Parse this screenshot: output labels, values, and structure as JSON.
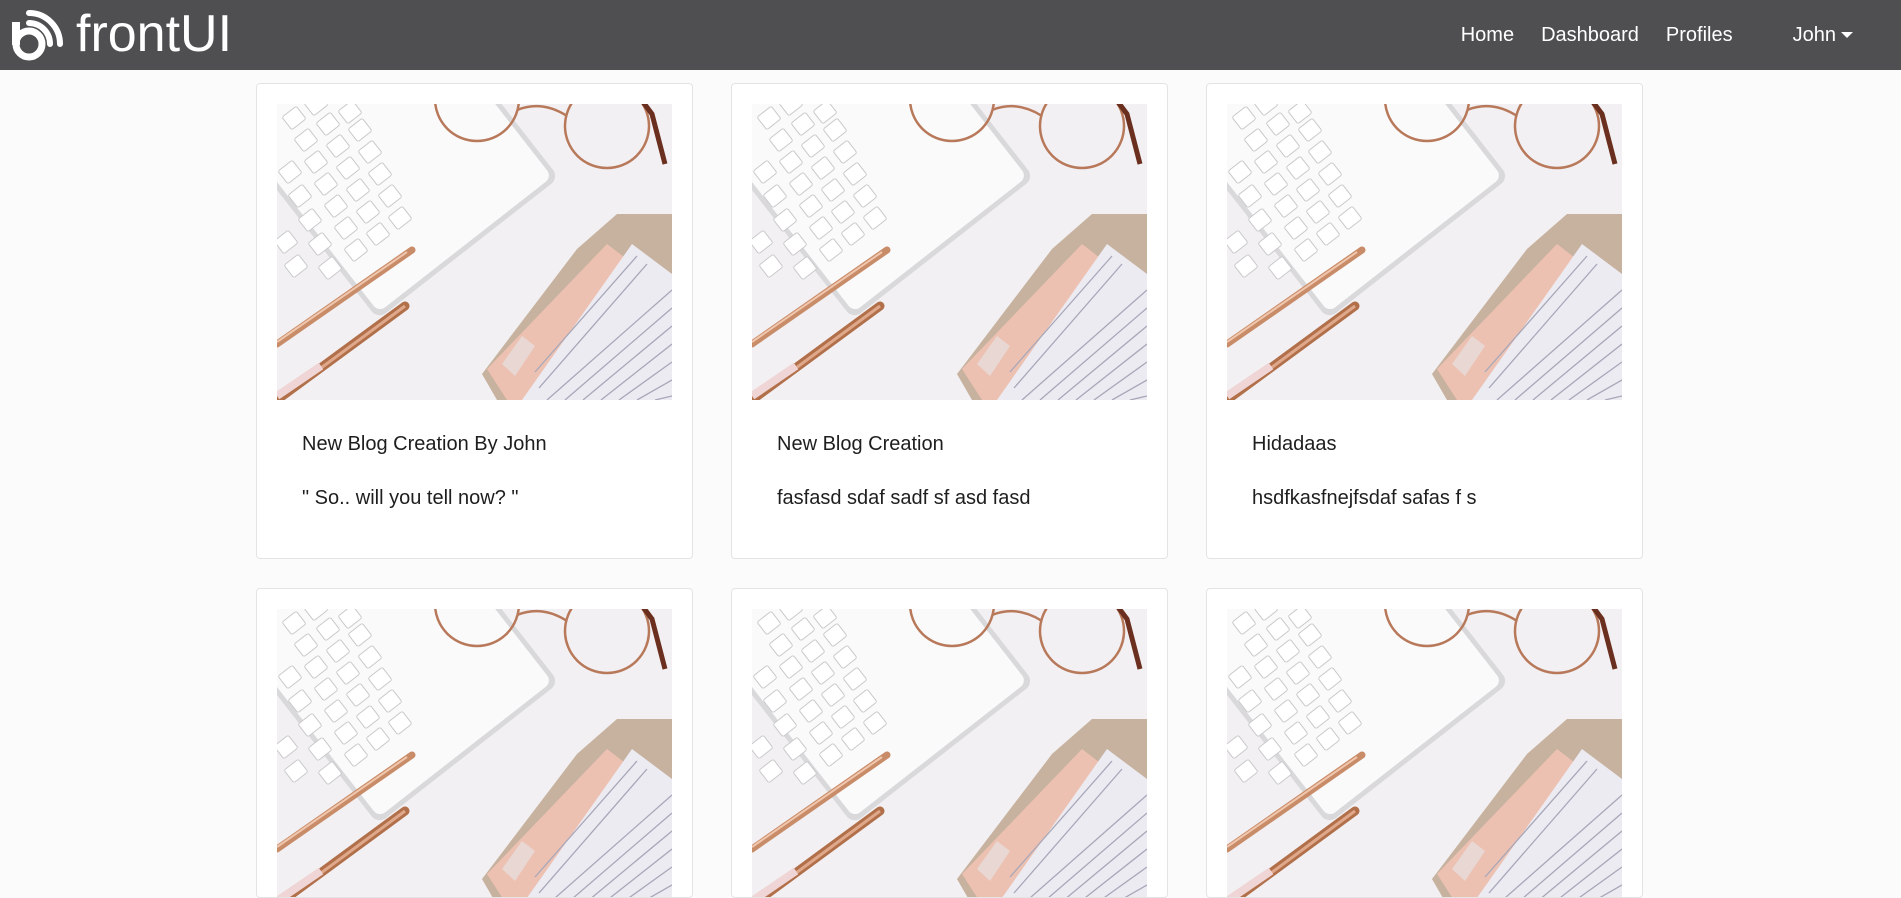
{
  "navbar": {
    "brand": "frontUI",
    "links": [
      "Home",
      "Dashboard",
      "Profiles"
    ],
    "user": "John"
  },
  "cards": [
    {
      "title": "New Blog Creation By John",
      "text": "\" So.. will you tell now? \""
    },
    {
      "title": "New Blog Creation",
      "text": "fasfasd sdaf sadf sf asd fasd"
    },
    {
      "title": "Hidadaas",
      "text": "hsdfkasfnejfsdaf safas f s"
    },
    {
      "title": "",
      "text": ""
    },
    {
      "title": "",
      "text": ""
    },
    {
      "title": "",
      "text": ""
    }
  ],
  "colors": {
    "navbar": "#4f4e50",
    "page_bg": "#fbfbfb",
    "card_border": "#e4e4e4"
  },
  "icons": {
    "brand": "wifi-logo-icon",
    "user_menu": "caret-down-icon"
  }
}
